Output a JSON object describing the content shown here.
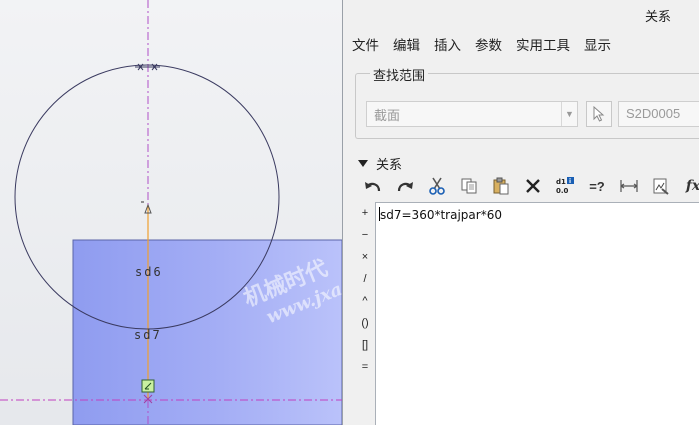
{
  "viewport": {
    "dimension_labels": [
      "sd6",
      "sd7"
    ],
    "watermark_line1": "机械时代",
    "watermark_line2": "www.jxag"
  },
  "dialog": {
    "title": "关系",
    "menu": [
      "文件",
      "编辑",
      "插入",
      "参数",
      "实用工具",
      "显示"
    ],
    "lookup": {
      "legend": "查找范围",
      "type_value": "截面",
      "object_value": "S2D0005"
    },
    "relations_header": "关系",
    "toolbar": [
      {
        "name": "undo-icon"
      },
      {
        "name": "redo-icon"
      },
      {
        "name": "cut-icon"
      },
      {
        "name": "copy-icon"
      },
      {
        "name": "paste-icon"
      },
      {
        "name": "delete-icon"
      },
      {
        "name": "value-toggle-icon"
      },
      {
        "name": "verify-icon",
        "label": "=?"
      },
      {
        "name": "insert-dimension-icon"
      },
      {
        "name": "unit-icon"
      },
      {
        "name": "function-icon",
        "label": "fx"
      }
    ],
    "operators": [
      "+",
      "−",
      "×",
      "/",
      "^",
      "()",
      "[]",
      "="
    ],
    "editor_text": "sd7=360*trajpar*60"
  }
}
